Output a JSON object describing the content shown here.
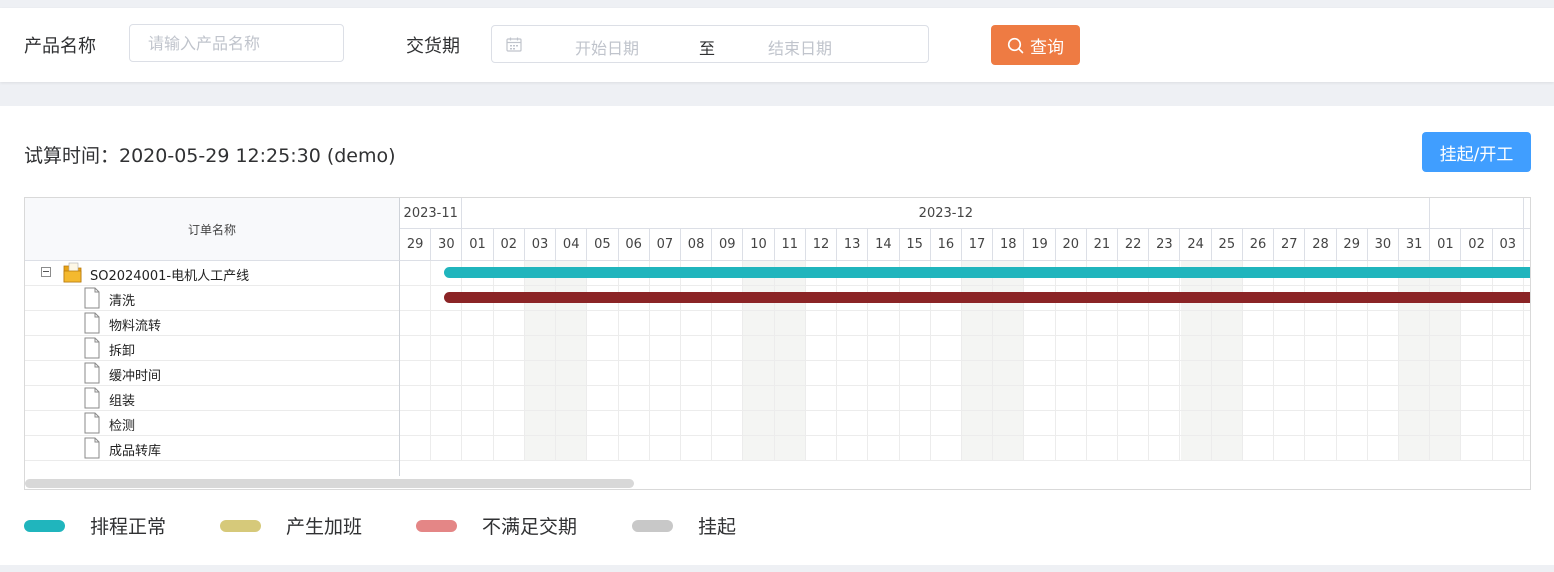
{
  "filters": {
    "product_label": "产品名称",
    "product_placeholder": "请输入产品名称",
    "delivery_label": "交货期",
    "start_placeholder": "开始日期",
    "range_separator": "至",
    "end_placeholder": "结束日期",
    "query_button": "查询"
  },
  "toolbar": {
    "trial_time": "试算时间：2020-05-29 12:25:30 (demo)",
    "suspend_button": "挂起/开工"
  },
  "gantt": {
    "grid_header": "订单名称",
    "order": "SO2024001-电机人工产线",
    "tasks": [
      "清洗",
      "物料流转",
      "拆卸",
      "缓冲时间",
      "组装",
      "检测",
      "成品转库"
    ],
    "months": [
      "2023-11",
      "2023-12",
      ""
    ],
    "days": [
      "29",
      "30",
      "01",
      "02",
      "03",
      "04",
      "05",
      "06",
      "07",
      "08",
      "09",
      "10",
      "11",
      "12",
      "13",
      "14",
      "15",
      "16",
      "17",
      "18",
      "19",
      "20",
      "21",
      "22",
      "23",
      "24",
      "25",
      "26",
      "27",
      "28",
      "29",
      "30",
      "31",
      "01",
      "02",
      "03"
    ],
    "weekend_days": [
      "2023-12-02",
      "2023-12-03",
      "2023-12-09",
      "2023-12-10",
      "2023-12-16",
      "2023-12-17",
      "2023-12-23",
      "2023-12-24",
      "2023-12-30",
      "2023-12-31"
    ],
    "bars": [
      {
        "row": "SO2024001-电机人工产线",
        "start": "2023-11-30",
        "end": "2024-01-03+",
        "color": "#20b5bd"
      },
      {
        "row": "清洗",
        "start": "2023-11-30",
        "end": "2024-01-03+",
        "color": "#8b2426"
      }
    ],
    "scrollbar_position": 0.4
  },
  "legend": [
    {
      "label": "排程正常",
      "color": "#20b5bd"
    },
    {
      "label": "产生加班",
      "color": "#d6c97a"
    },
    {
      "label": "不满足交期",
      "color": "#e48686"
    },
    {
      "label": "挂起",
      "color": "#c8c8c8"
    }
  ],
  "colors": {
    "query_button": "#ee7b43",
    "suspend_button": "#409eff"
  }
}
